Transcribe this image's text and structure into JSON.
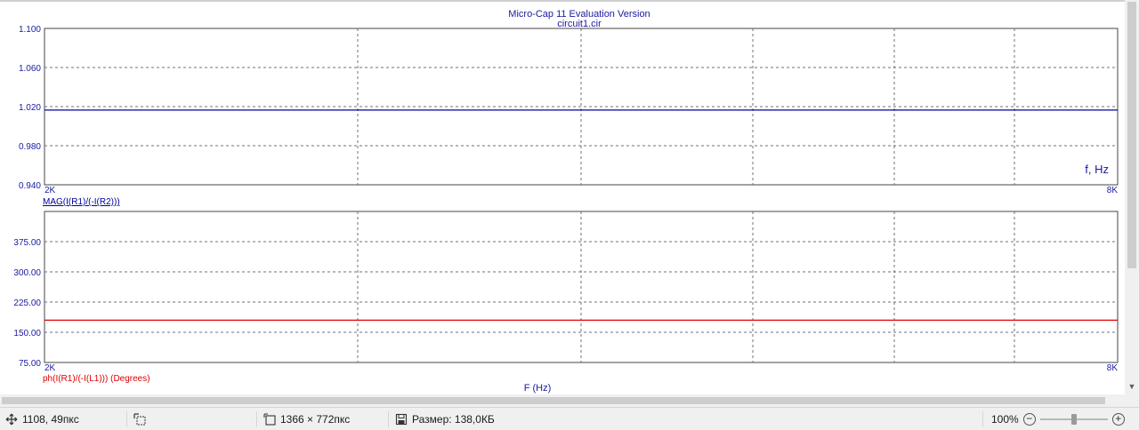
{
  "plot": {
    "title": "Micro-Cap 11 Evaluation Version",
    "subtitle": "circuit1.cir",
    "corner_label": "f, Hz",
    "x_axis_title": "F (Hz)"
  },
  "chart_data": [
    {
      "type": "line",
      "ylim": [
        0.94,
        1.1
      ],
      "yticks": [
        "1.100",
        "1.060",
        "1.020",
        "0.980",
        "0.940"
      ],
      "xlim": [
        2000,
        8000
      ],
      "xtick_labels": [
        "2K",
        "8K"
      ],
      "grid": true,
      "series": [
        {
          "name": "MAG(I(R1)/(-I(R2)))",
          "color": "#0000a0",
          "x": [
            2000,
            8000
          ],
          "y": [
            1.0165,
            1.0165
          ]
        }
      ]
    },
    {
      "type": "line",
      "ylim": [
        75,
        450
      ],
      "yticks": [
        "375.00",
        "300.00",
        "225.00",
        "150.00",
        "75.00"
      ],
      "xlim": [
        2000,
        8000
      ],
      "xtick_labels": [
        "2K",
        "8K"
      ],
      "grid": true,
      "series": [
        {
          "name": "ph(I(R1)/(-I(L1))) (Degrees)",
          "color": "#e00000",
          "x": [
            2000,
            8000
          ],
          "y": [
            180,
            180
          ]
        }
      ]
    }
  ],
  "statusbar": {
    "cursor_pos": "1108, 49пкс",
    "dimensions": "1366 × 772пкс",
    "file_size": "Размер: 138,0КБ",
    "zoom": "100%",
    "zoom_out_label": "−",
    "zoom_in_label": "+",
    "zoom_level": 0.5
  },
  "icons": {
    "cursor": "move-cursor-icon",
    "selection": "selection-icon",
    "dimensions": "image-size-icon",
    "file_size": "save-disk-icon"
  }
}
